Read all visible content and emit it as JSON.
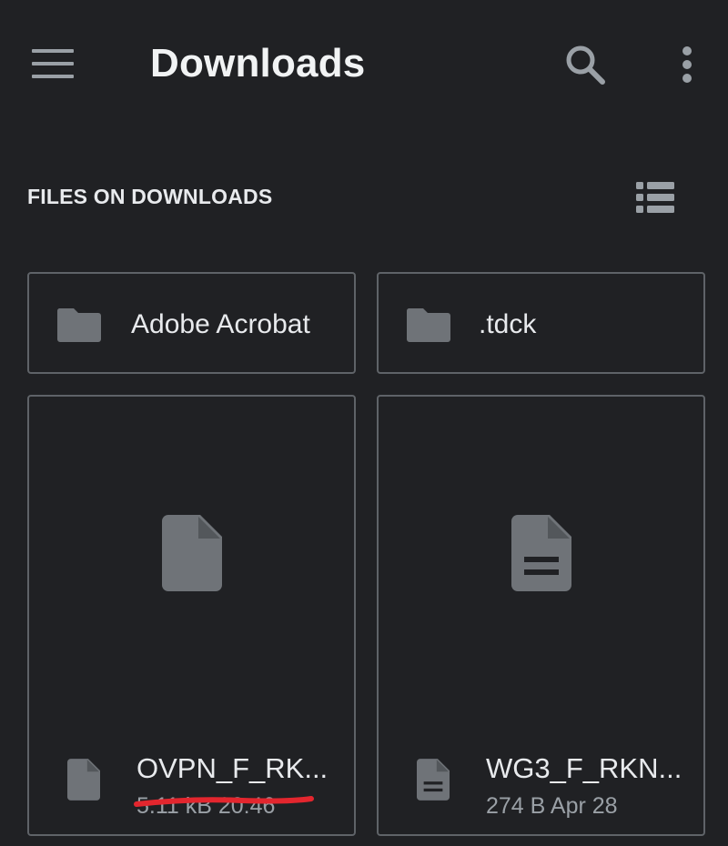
{
  "appbar": {
    "title": "Downloads",
    "menu_icon": "hamburger-menu-icon",
    "search_icon": "search-icon",
    "more_icon": "more-vert-icon"
  },
  "section": {
    "label": "FILES ON DOWNLOADS",
    "view_toggle_icon": "list-view-icon"
  },
  "folders": [
    {
      "name": "Adobe Acrobat",
      "icon": "folder-icon"
    },
    {
      "name": ".tdck",
      "icon": "folder-icon"
    }
  ],
  "files": [
    {
      "name": "OVPN_F_RK...",
      "meta": "5.11 kB 20:46",
      "icon": "file-icon",
      "meta_redacted": true
    },
    {
      "name": "WG3_F_RKN...",
      "meta": "274 B  Apr 28",
      "icon": "document-icon",
      "meta_redacted": false
    }
  ],
  "colors": {
    "background": "#202124",
    "card_border": "#5f6368",
    "icon_gray": "#6f7378",
    "redaction": "#e3262e"
  }
}
